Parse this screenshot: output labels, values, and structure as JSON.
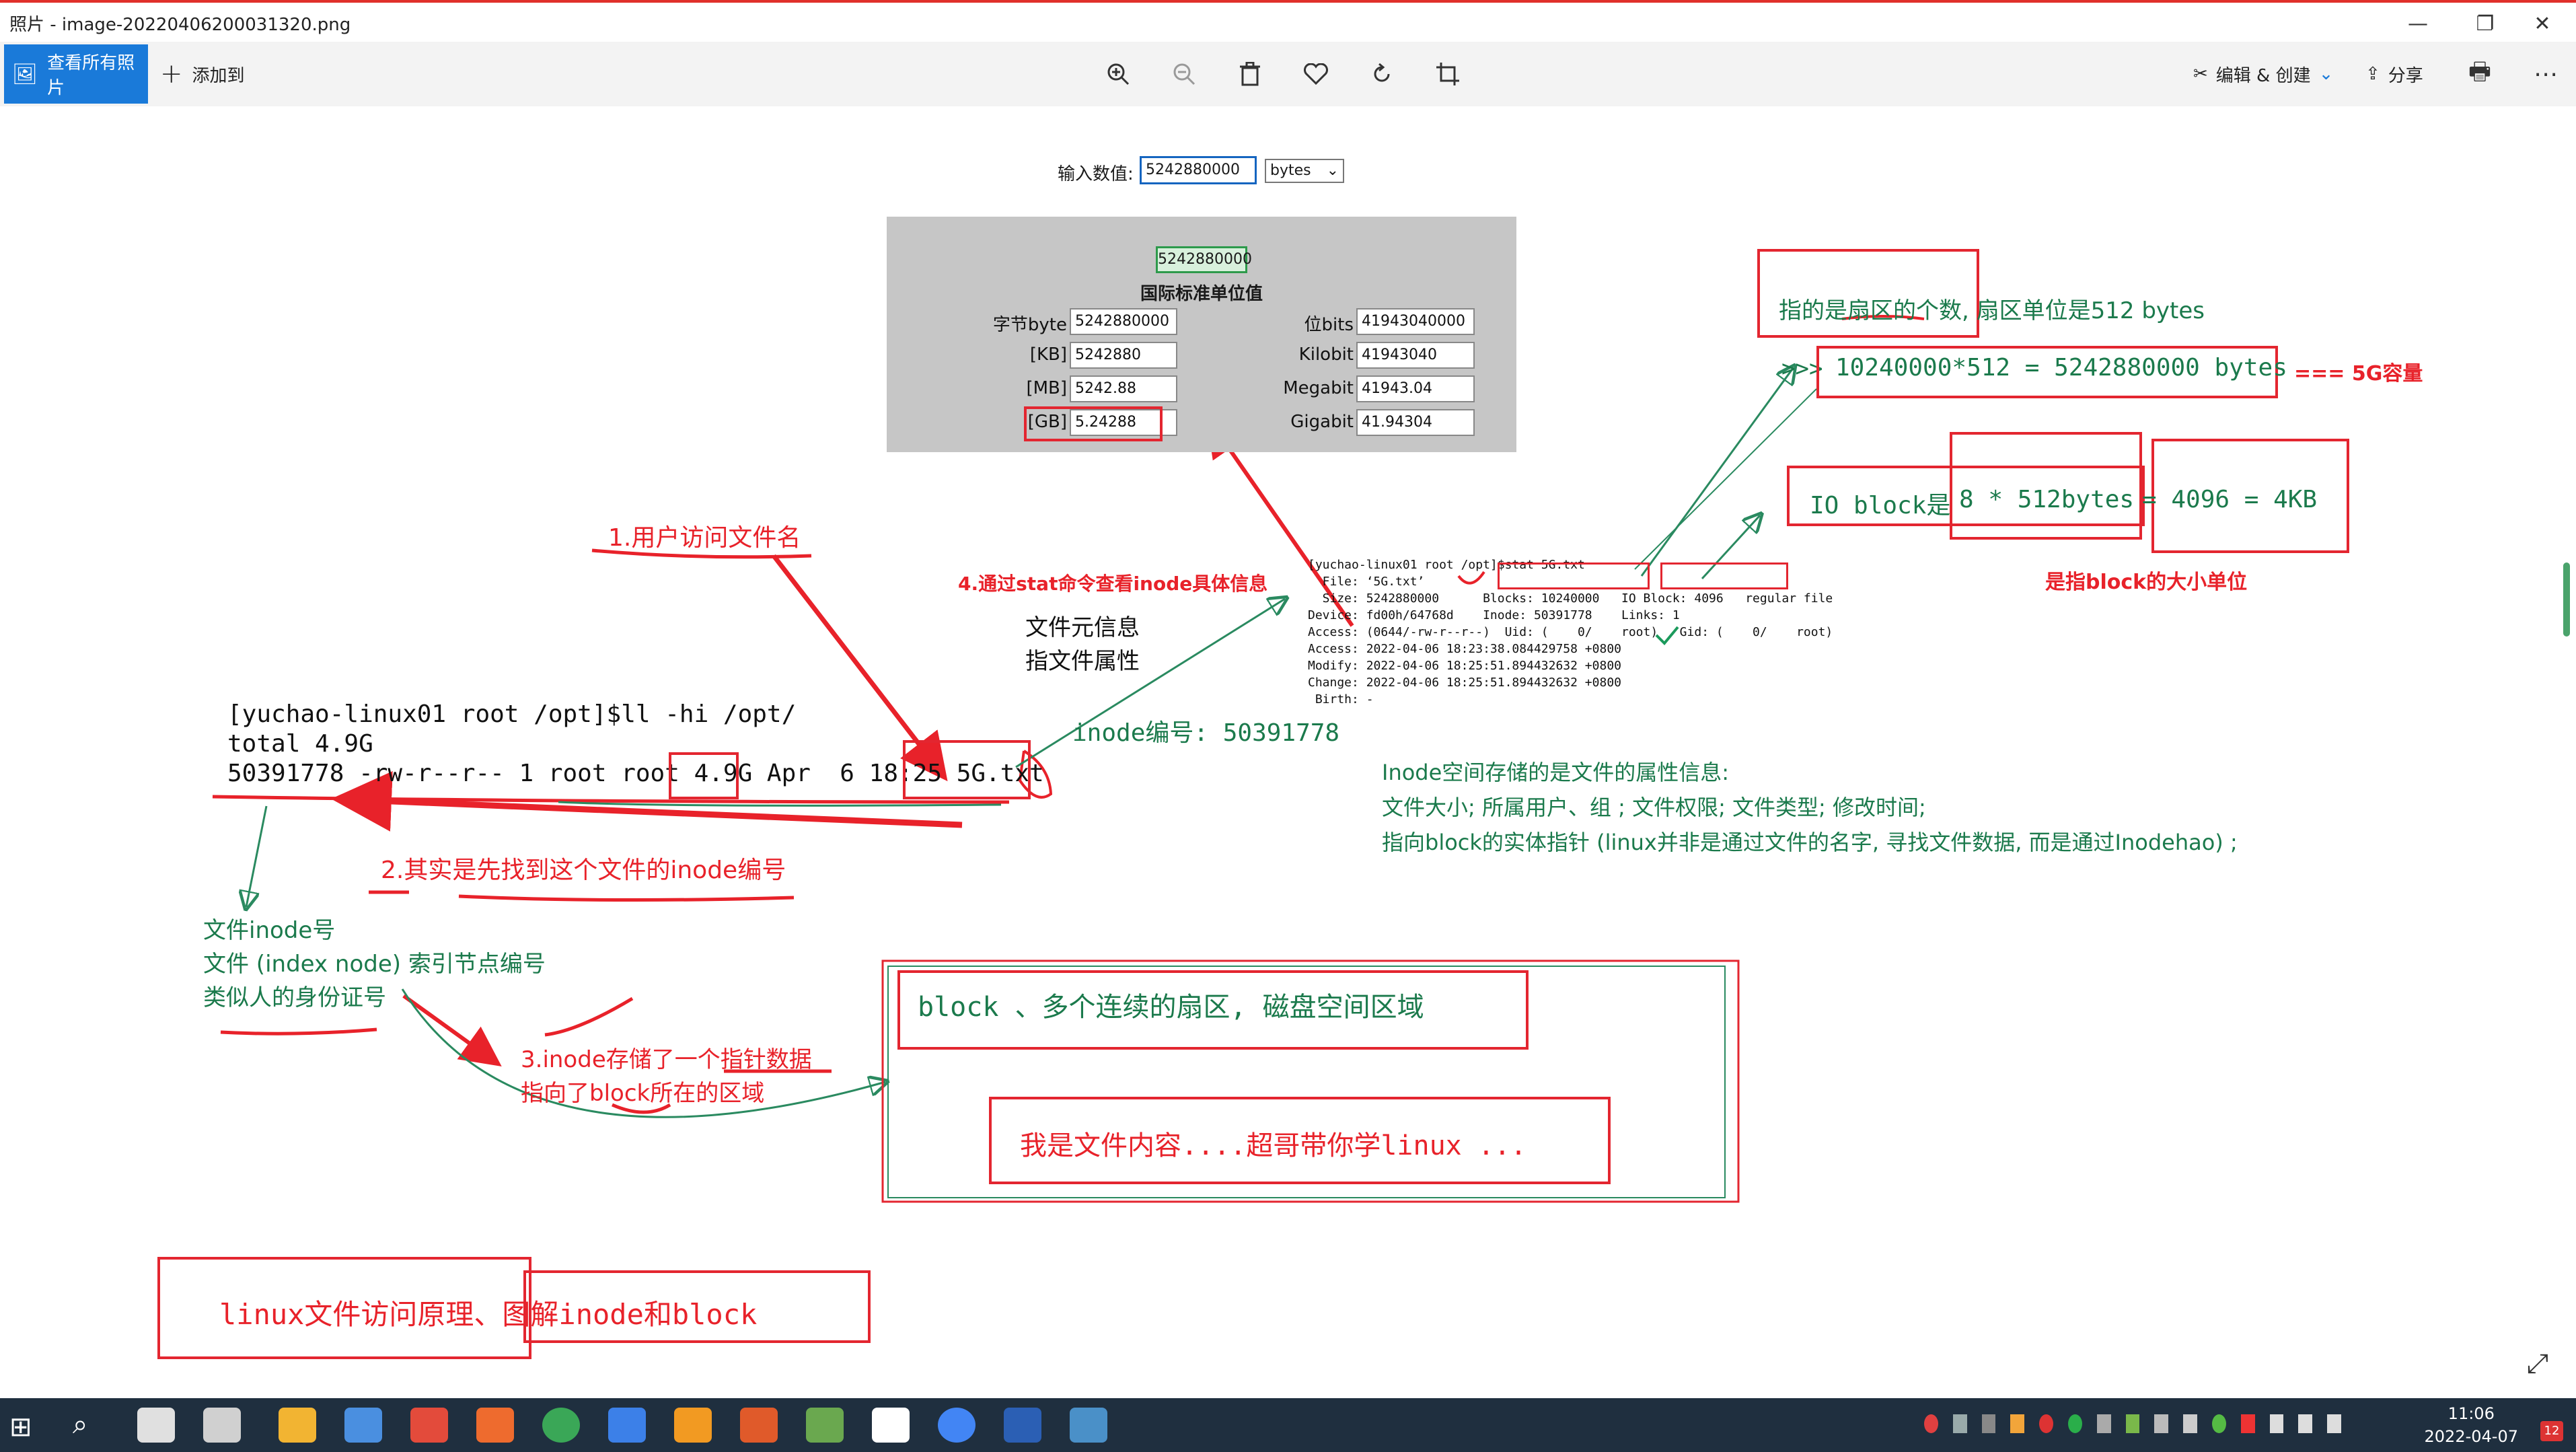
{
  "window": {
    "title": "照片 - image-20220406200031320.png",
    "minimize_icon": "minimize-icon",
    "maximize_icon": "maximize-icon",
    "close_icon": "close-icon"
  },
  "toolbar": {
    "view_all_label": "查看所有照片",
    "add_to_label": "添加到",
    "edit_create_label": "编辑 & 创建",
    "share_label": "分享",
    "icons": [
      "zoom-in-icon",
      "zoom-out-icon",
      "delete-icon",
      "heart-icon",
      "rotate-icon",
      "crop-icon",
      "print-icon",
      "more-icon"
    ]
  },
  "converter": {
    "label": "输入数值:",
    "input_value": "5242880000",
    "unit_select": "bytes",
    "highlight_value": "5242880000",
    "section_title": "国际标准单位值",
    "left_rows": [
      {
        "label": "字节byte",
        "value": "5242880000"
      },
      {
        "label": "[KB]",
        "value": "5242880"
      },
      {
        "label": "[MB]",
        "value": "5242.88"
      },
      {
        "label": "[GB]",
        "value": "5.24288"
      }
    ],
    "right_rows": [
      {
        "label": "位bits",
        "value": "41943040000"
      },
      {
        "label": "Kilobit",
        "value": "41943040"
      },
      {
        "label": "Megabit",
        "value": "41943.04"
      },
      {
        "label": "Gigabit",
        "value": "41.94304"
      }
    ]
  },
  "stat_output": {
    "lines": [
      "[yuchao-linux01 root /opt]$stat 5G.txt",
      "  File: ‘5G.txt’",
      "  Size: 5242880000      Blocks: 10240000   IO Block: 4096   regular file",
      "Device: fd00h/64768d    Inode: 50391778    Links: 1",
      "Access: (0644/-rw-r--r--)  Uid: (    0/    root)   Gid: (    0/    root)",
      "Access: 2022-04-06 18:23:38.084429758 +0800",
      "Modify: 2022-04-06 18:25:51.894432632 +0800",
      "Change: 2022-04-06 18:25:51.894432632 +0800",
      " Birth: -"
    ]
  },
  "terminal": {
    "line1": "[yuchao-linux01 root /opt]$ll -hi /opt/",
    "line2": "total 4.9G",
    "line3": "50391778 -rw-r--r-- 1 root root 4.9G Apr  6 18:25 5G.txt"
  },
  "annotations": {
    "step1": "1.用户访问文件名",
    "step2": "2.其实是先找到这个文件的inode编号",
    "step3_line1": "3.inode存储了一个指针数据",
    "step3_line2": "指向了block所在的区域",
    "step4": "4.通过stat命令查看inode具体信息",
    "meta1": "文件元信息",
    "meta2": "指文件属性",
    "inode_num": "inode编号: 50391778",
    "inode_title": "文件inode号",
    "inode_desc1": "文件 (index node)  索引节点编号",
    "inode_desc2": "类似人的身份证号",
    "sector_note": "指的是扇区的个数, 扇区单位是512 bytes",
    "calc": "10240000*512 = 5242880000 bytes",
    "calc_prefix": ">>>",
    "calc_suffix": "=== 5G容量",
    "ioblock_a": "IO block是",
    "ioblock_b": "8 * 512bytes",
    "ioblock_c": "= 4096 = 4KB",
    "ioblock_note": "是指block的大小单位",
    "inode_info1": "Inode空间存储的是文件的属性信息:",
    "inode_info2": "文件大小; 所属用户、组 ; 文件权限; 文件类型; 修改时间;",
    "inode_info3": "指向block的实体指针 (linux并非是通过文件的名字, 寻找文件数据, 而是通过Inodehao) ;",
    "block_title": "block 、多个连续的扇区, 磁盘空间区域",
    "block_content": "我是文件内容....超哥带你学linux ...",
    "footer_title": "linux文件访问原理、图解inode和block"
  },
  "taskbar": {
    "time": "11:06",
    "date": "2022-04-07",
    "notification_count": "12"
  },
  "colors": {
    "accent_blue": "#1a7ad9",
    "annotation_red": "#e8222a",
    "annotation_green": "#1b7a4c",
    "taskbar": "#1f2f3f"
  }
}
